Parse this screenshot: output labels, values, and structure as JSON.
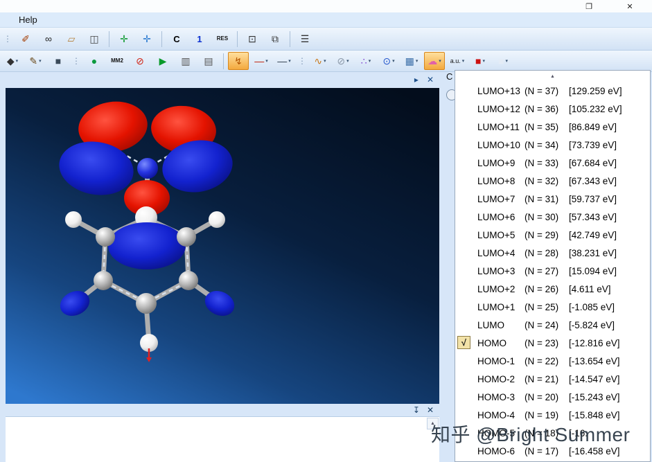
{
  "window": {
    "restore_glyph": "❐",
    "close_glyph": "✕"
  },
  "menu": {
    "help_label": "Help"
  },
  "icons": {
    "caret": "▾",
    "panel_expand": "▸",
    "panel_close": "✕",
    "pin": "↧",
    "footer_close": "✕",
    "scroll_up": "▲",
    "side_tab_label": "C"
  },
  "toolbar_row1": [
    {
      "t": "grip"
    },
    {
      "name": "marker-pen-button",
      "g": "✐",
      "c": "#a33c00"
    },
    {
      "name": "view-glasses-button",
      "g": "∞",
      "c": "#222222"
    },
    {
      "name": "eraser-button",
      "g": "▱",
      "c": "#b5803a"
    },
    {
      "name": "stamp-tool-button",
      "g": "◫",
      "c": "#444444"
    },
    {
      "t": "sep"
    },
    {
      "name": "move-atoms-button",
      "g": "✛",
      "c": "#0f9a30"
    },
    {
      "name": "rotate-atoms-button",
      "g": "✛",
      "c": "#2a7ad0"
    },
    {
      "t": "sep"
    },
    {
      "name": "show-atom-symbols-button",
      "g": "C",
      "c": "#000000",
      "fs": "13",
      "bold": true
    },
    {
      "name": "show-atom-numbers-button",
      "g": "1",
      "c": "#0a2fd0",
      "fs": "13",
      "bold": true
    },
    {
      "name": "show-residues-button",
      "g": "RES",
      "c": "#111111",
      "fs": "8",
      "bold": true
    },
    {
      "t": "sep"
    },
    {
      "name": "presentation-display-button",
      "g": "⊡",
      "c": "#333333"
    },
    {
      "name": "dual-display-button",
      "g": "⧉",
      "c": "#333333"
    },
    {
      "t": "sep"
    },
    {
      "name": "serial-numbers-button",
      "g": "☰",
      "c": "#333333"
    }
  ],
  "toolbar_row2": [
    {
      "name": "select-move-button",
      "g": "◆",
      "c": "#333333",
      "dd": true
    },
    {
      "name": "orbit-brush-button",
      "g": "✎",
      "c": "#6a4a1a",
      "dd": true
    },
    {
      "name": "background-color-button",
      "g": "■",
      "c": "#3a4a5a"
    },
    {
      "t": "grip"
    },
    {
      "name": "model-sphere-button",
      "g": "●",
      "c": "#0c9a3e"
    },
    {
      "name": "mm2-minimize-button",
      "g": "MM2",
      "c": "#111111",
      "fs": "8",
      "bold": true
    },
    {
      "name": "stop-calculation-button",
      "g": "⊘",
      "c": "#d02010"
    },
    {
      "name": "run-job-button",
      "g": "▶",
      "c": "#0a9a2a"
    },
    {
      "name": "measure-distance-button",
      "g": "▥",
      "c": "#555555"
    },
    {
      "name": "measure-angle-button",
      "g": "▤",
      "c": "#555555"
    },
    {
      "t": "sep"
    },
    {
      "name": "compute-lightning-button",
      "g": "↯",
      "c": "#b35400",
      "sel": true
    },
    {
      "name": "bond-tool-red-button",
      "g": "—",
      "c": "#c01800",
      "dd": true
    },
    {
      "name": "bond-tool-dark-button",
      "g": "—",
      "c": "#2a3a4a",
      "dd": true
    },
    {
      "t": "grip"
    },
    {
      "name": "helix-tool-button",
      "g": "∿",
      "c": "#c87818",
      "dd": true
    },
    {
      "name": "hide-surface-button",
      "g": "⊘",
      "c": "#8a98a8",
      "dd": true
    },
    {
      "name": "dot-surface-button",
      "g": "∴",
      "c": "#7a3ad0",
      "dd": true
    },
    {
      "name": "orbital-display-button",
      "g": "⊙",
      "c": "#2255cc",
      "dd": true
    },
    {
      "name": "grid-surface-button",
      "g": "▦",
      "c": "#3a6ea8",
      "dd": true
    },
    {
      "name": "solvent-surface-button",
      "g": "☁",
      "c": "#e060a8",
      "dd": true,
      "sel": true
    },
    {
      "name": "units-au-button",
      "g": "a.u.",
      "c": "#111111",
      "fs": "9",
      "dd": true
    },
    {
      "name": "color-red-swatch-button",
      "g": "■",
      "c": "#cc1111",
      "dd": true
    },
    {
      "name": "color-white-swatch-button",
      "g": "■",
      "c": "#e4ecf6",
      "dd": true
    }
  ],
  "orbital_panel": {
    "check_glyph": "√",
    "rows": [
      {
        "label": "LUMO+13",
        "n": "(N = 37)",
        "energy": "[129.259 eV]",
        "checked": false
      },
      {
        "label": "LUMO+12",
        "n": "(N = 36)",
        "energy": "[105.232 eV]",
        "checked": false
      },
      {
        "label": "LUMO+11",
        "n": "(N = 35)",
        "energy": "[86.849 eV]",
        "checked": false
      },
      {
        "label": "LUMO+10",
        "n": "(N = 34)",
        "energy": "[73.739 eV]",
        "checked": false
      },
      {
        "label": "LUMO+9",
        "n": "(N = 33)",
        "energy": "[67.684 eV]",
        "checked": false
      },
      {
        "label": "LUMO+8",
        "n": "(N = 32)",
        "energy": "[67.343 eV]",
        "checked": false
      },
      {
        "label": "LUMO+7",
        "n": "(N = 31)",
        "energy": "[59.737 eV]",
        "checked": false
      },
      {
        "label": "LUMO+6",
        "n": "(N = 30)",
        "energy": "[57.343 eV]",
        "checked": false
      },
      {
        "label": "LUMO+5",
        "n": "(N = 29)",
        "energy": "[42.749 eV]",
        "checked": false
      },
      {
        "label": "LUMO+4",
        "n": "(N = 28)",
        "energy": "[38.231 eV]",
        "checked": false
      },
      {
        "label": "LUMO+3",
        "n": "(N = 27)",
        "energy": "[15.094 eV]",
        "checked": false
      },
      {
        "label": "LUMO+2",
        "n": "(N = 26)",
        "energy": "[4.611 eV]",
        "checked": false
      },
      {
        "label": "LUMO+1",
        "n": "(N = 25)",
        "energy": "[-1.085 eV]",
        "checked": false
      },
      {
        "label": "LUMO",
        "n": "(N = 24)",
        "energy": "[-5.824 eV]",
        "checked": false
      },
      {
        "label": "HOMO",
        "n": "(N = 23)",
        "energy": "[-12.816 eV]",
        "checked": true
      },
      {
        "label": "HOMO-1",
        "n": "(N = 22)",
        "energy": "[-13.654 eV]",
        "checked": false
      },
      {
        "label": "HOMO-2",
        "n": "(N = 21)",
        "energy": "[-14.547 eV]",
        "checked": false
      },
      {
        "label": "HOMO-3",
        "n": "(N = 20)",
        "energy": "[-15.243 eV]",
        "checked": false
      },
      {
        "label": "HOMO-4",
        "n": "(N = 19)",
        "energy": "[-15.848 eV]",
        "checked": false
      },
      {
        "label": "HOMO-5",
        "n": "(N = 18)",
        "energy": "[-16.",
        "checked": false
      },
      {
        "label": "HOMO-6",
        "n": "(N = 17)",
        "energy": "[-16.458 eV]",
        "checked": false
      }
    ]
  },
  "watermark": {
    "text": "知乎 @Bright Summer"
  },
  "molecule": {
    "shapes": [
      {
        "t": "bond",
        "p": [
          203,
          188,
          205,
          115
        ]
      },
      {
        "t": "dash",
        "p": [
          200,
          112,
          150,
          84
        ]
      },
      {
        "t": "dash",
        "p": [
          210,
          112,
          260,
          84
        ]
      },
      {
        "t": "bond",
        "p": [
          144,
          215,
          203,
          188
        ]
      },
      {
        "t": "bond",
        "p": [
          261,
          215,
          203,
          188
        ]
      },
      {
        "t": "bond",
        "p": [
          144,
          215,
          141,
          278
        ]
      },
      {
        "t": "bond",
        "p": [
          261,
          215,
          264,
          278
        ]
      },
      {
        "t": "bond",
        "p": [
          141,
          278,
          203,
          311
        ]
      },
      {
        "t": "bond",
        "p": [
          264,
          278,
          203,
          311
        ]
      },
      {
        "t": "bond",
        "p": [
          144,
          215,
          98,
          190
        ]
      },
      {
        "t": "bond",
        "p": [
          261,
          215,
          305,
          190
        ]
      },
      {
        "t": "bond",
        "p": [
          203,
          311,
          207,
          368
        ]
      },
      {
        "t": "bond",
        "p": [
          141,
          278,
          100,
          310
        ]
      },
      {
        "t": "bond",
        "p": [
          264,
          278,
          309,
          310
        ]
      },
      {
        "t": "dash",
        "p": [
          144,
          219,
          141,
          274
        ]
      },
      {
        "t": "dash",
        "p": [
          261,
          219,
          264,
          274
        ]
      },
      {
        "t": "dash",
        "p": [
          144,
          281,
          200,
          308
        ]
      },
      {
        "t": "dash",
        "p": [
          261,
          281,
          206,
          308
        ]
      },
      {
        "t": "lobe",
        "p": [
          155,
          56,
          50,
          36,
          -8
        ],
        "c": "red"
      },
      {
        "t": "lobe",
        "p": [
          257,
          60,
          47,
          34,
          6
        ],
        "c": "red"
      },
      {
        "t": "lobe",
        "p": [
          131,
          116,
          54,
          38,
          10
        ],
        "c": "blue"
      },
      {
        "t": "lobe",
        "p": [
          277,
          113,
          51,
          37,
          -10
        ],
        "c": "blue"
      },
      {
        "t": "atom",
        "p": [
          205,
          116,
          15
        ],
        "c": "blue"
      },
      {
        "t": "lobe",
        "p": [
          204,
          159,
          33,
          26,
          0
        ],
        "c": "red"
      },
      {
        "t": "atom",
        "p": [
          203,
          187,
          16
        ],
        "c": "white"
      },
      {
        "t": "lobe",
        "p": [
          204,
          228,
          56,
          34,
          0
        ],
        "c": "blue"
      },
      {
        "t": "atom",
        "p": [
          144,
          215,
          14
        ],
        "c": "gray"
      },
      {
        "t": "atom",
        "p": [
          261,
          215,
          14
        ],
        "c": "gray"
      },
      {
        "t": "atom",
        "p": [
          141,
          278,
          14
        ],
        "c": "gray"
      },
      {
        "t": "atom",
        "p": [
          264,
          278,
          14
        ],
        "c": "gray"
      },
      {
        "t": "atom",
        "p": [
          203,
          311,
          15
        ],
        "c": "gray"
      },
      {
        "t": "atom",
        "p": [
          98,
          190,
          12
        ],
        "c": "white"
      },
      {
        "t": "atom",
        "p": [
          305,
          190,
          12
        ],
        "c": "white"
      },
      {
        "t": "atom",
        "p": [
          207,
          368,
          13
        ],
        "c": "white"
      },
      {
        "t": "lobe",
        "p": [
          100,
          311,
          22,
          17,
          -25
        ],
        "c": "blue"
      },
      {
        "t": "lobe",
        "p": [
          309,
          311,
          22,
          17,
          25
        ],
        "c": "blue"
      },
      {
        "t": "arrow",
        "p": [
          207,
          376,
          207,
          394
        ]
      }
    ]
  }
}
